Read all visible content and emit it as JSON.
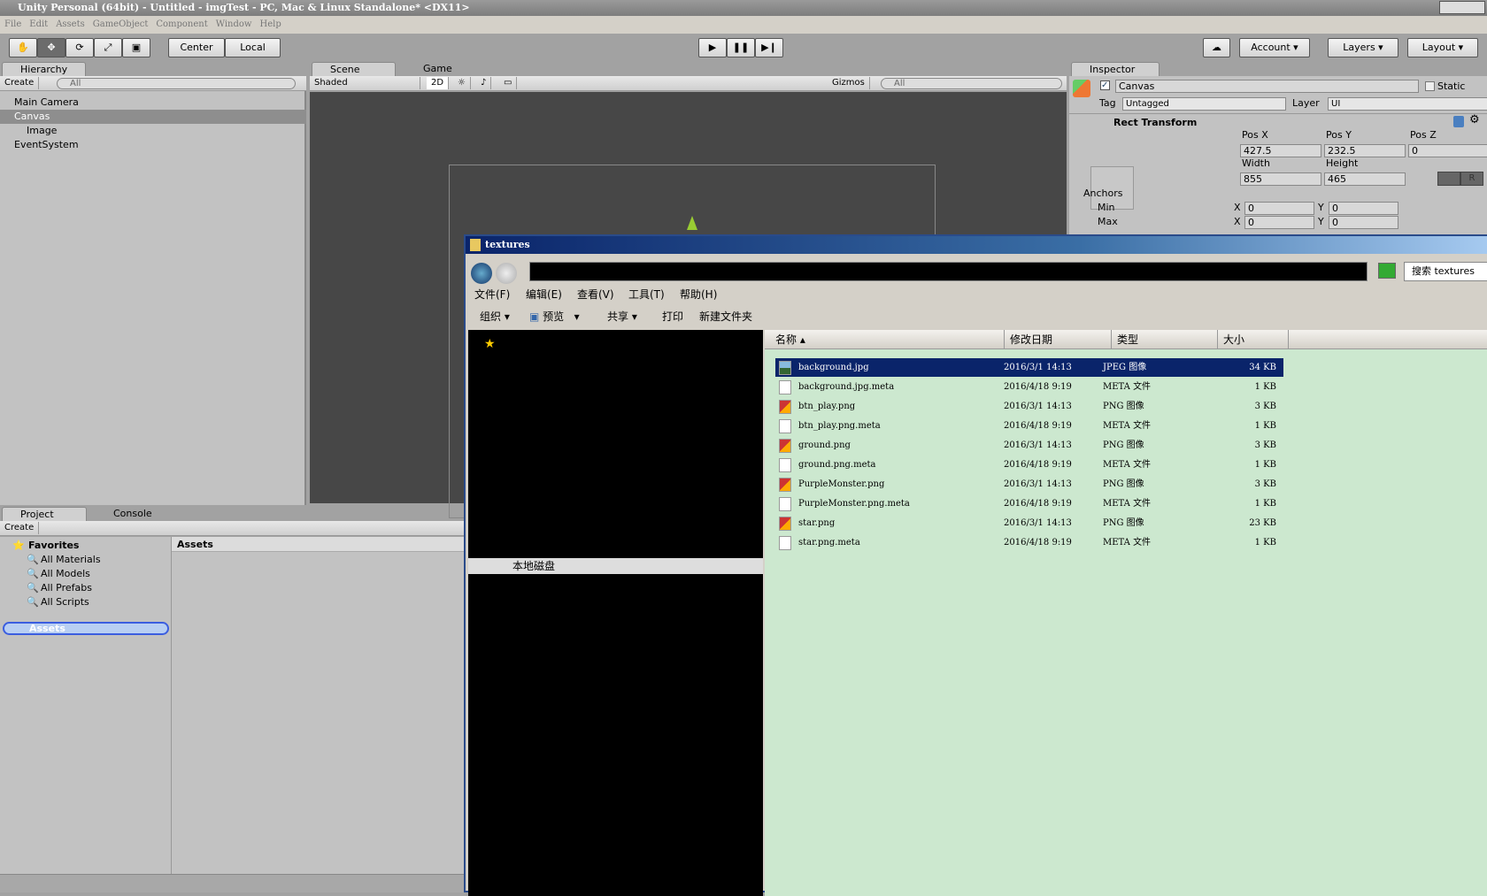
{
  "window": {
    "title": "Unity Personal (64bit) - Untitled - imgTest - PC, Mac & Linux Standalone* <DX11>"
  },
  "menu": [
    "File",
    "Edit",
    "Assets",
    "GameObject",
    "Component",
    "Window",
    "Help"
  ],
  "toolbar": {
    "tools": [
      "hand-icon",
      "move-icon",
      "rotate-icon",
      "scale-icon",
      "rect-icon"
    ],
    "active_tool": "move-icon",
    "pivot": "Center",
    "space": "Local",
    "account": "Account",
    "layers": "Layers",
    "layout": "Layout"
  },
  "hierarchy": {
    "tab": "Hierarchy",
    "create": "Create",
    "search_placeholder": "All",
    "items": [
      {
        "label": "Main Camera"
      },
      {
        "label": "Canvas",
        "selected": true
      },
      {
        "label": "Image"
      },
      {
        "label": "EventSystem"
      }
    ]
  },
  "scene": {
    "tabs": [
      "Scene",
      "Game"
    ],
    "shading": "Shaded",
    "mode_2d": "2D",
    "gizmos": "Gizmos",
    "search_placeholder": "All"
  },
  "inspector": {
    "tab": "Inspector",
    "object_name": "Canvas",
    "static_label": "Static",
    "tag_label": "Tag",
    "tag": "Untagged",
    "layer_label": "Layer",
    "layer": "UI",
    "component": "Rect Transform",
    "pos_x_label": "Pos X",
    "pos_y_label": "Pos Y",
    "pos_z_label": "Pos Z",
    "pos_x": "427.5",
    "pos_y": "232.5",
    "pos_z": "0",
    "width_label": "Width",
    "height_label": "Height",
    "width": "855",
    "height": "465",
    "anchors": "Anchors",
    "min": "Min",
    "max": "Max",
    "x": "X",
    "y": "Y",
    "min_x": "0",
    "min_y": "0",
    "max_x": "0",
    "max_y": "0",
    "r_button": "R"
  },
  "project": {
    "tabs": [
      "Project",
      "Console"
    ],
    "create": "Create",
    "favorites": "Favorites",
    "fav_items": [
      "All Materials",
      "All Models",
      "All Prefabs",
      "All Scripts"
    ],
    "assets": "Assets",
    "assets_header": "Assets"
  },
  "explorer": {
    "title": "textures",
    "search_placeholder": "搜索 textures",
    "menu": [
      "文件(F)",
      "编辑(E)",
      "查看(V)",
      "工具(T)",
      "帮助(H)"
    ],
    "toolbar": [
      "组织",
      "预览",
      "共享",
      "打印",
      "新建文件夹"
    ],
    "nav_selected": "本地磁盘",
    "columns": [
      "名称",
      "修改日期",
      "类型",
      "大小"
    ],
    "files": [
      {
        "name": "background.jpg",
        "date": "2016/3/1 14:13",
        "type": "JPEG 图像",
        "size": "34 KB",
        "icon": "jpeg-icon",
        "selected": true
      },
      {
        "name": "background.jpg.meta",
        "date": "2016/4/18 9:19",
        "type": "META 文件",
        "size": "1 KB",
        "icon": "file-icon"
      },
      {
        "name": "btn_play.png",
        "date": "2016/3/1 14:13",
        "type": "PNG 图像",
        "size": "3 KB",
        "icon": "png-icon"
      },
      {
        "name": "btn_play.png.meta",
        "date": "2016/4/18 9:19",
        "type": "META 文件",
        "size": "1 KB",
        "icon": "file-icon"
      },
      {
        "name": "ground.png",
        "date": "2016/3/1 14:13",
        "type": "PNG 图像",
        "size": "3 KB",
        "icon": "png-icon"
      },
      {
        "name": "ground.png.meta",
        "date": "2016/4/18 9:19",
        "type": "META 文件",
        "size": "1 KB",
        "icon": "file-icon"
      },
      {
        "name": "PurpleMonster.png",
        "date": "2016/3/1 14:13",
        "type": "PNG 图像",
        "size": "3 KB",
        "icon": "png-icon"
      },
      {
        "name": "PurpleMonster.png.meta",
        "date": "2016/4/18 9:19",
        "type": "META 文件",
        "size": "1 KB",
        "icon": "file-icon"
      },
      {
        "name": "star.png",
        "date": "2016/3/1 14:13",
        "type": "PNG 图像",
        "size": "23 KB",
        "icon": "png-icon"
      },
      {
        "name": "star.png.meta",
        "date": "2016/4/18 9:19",
        "type": "META 文件",
        "size": "1 KB",
        "icon": "file-icon"
      }
    ]
  }
}
